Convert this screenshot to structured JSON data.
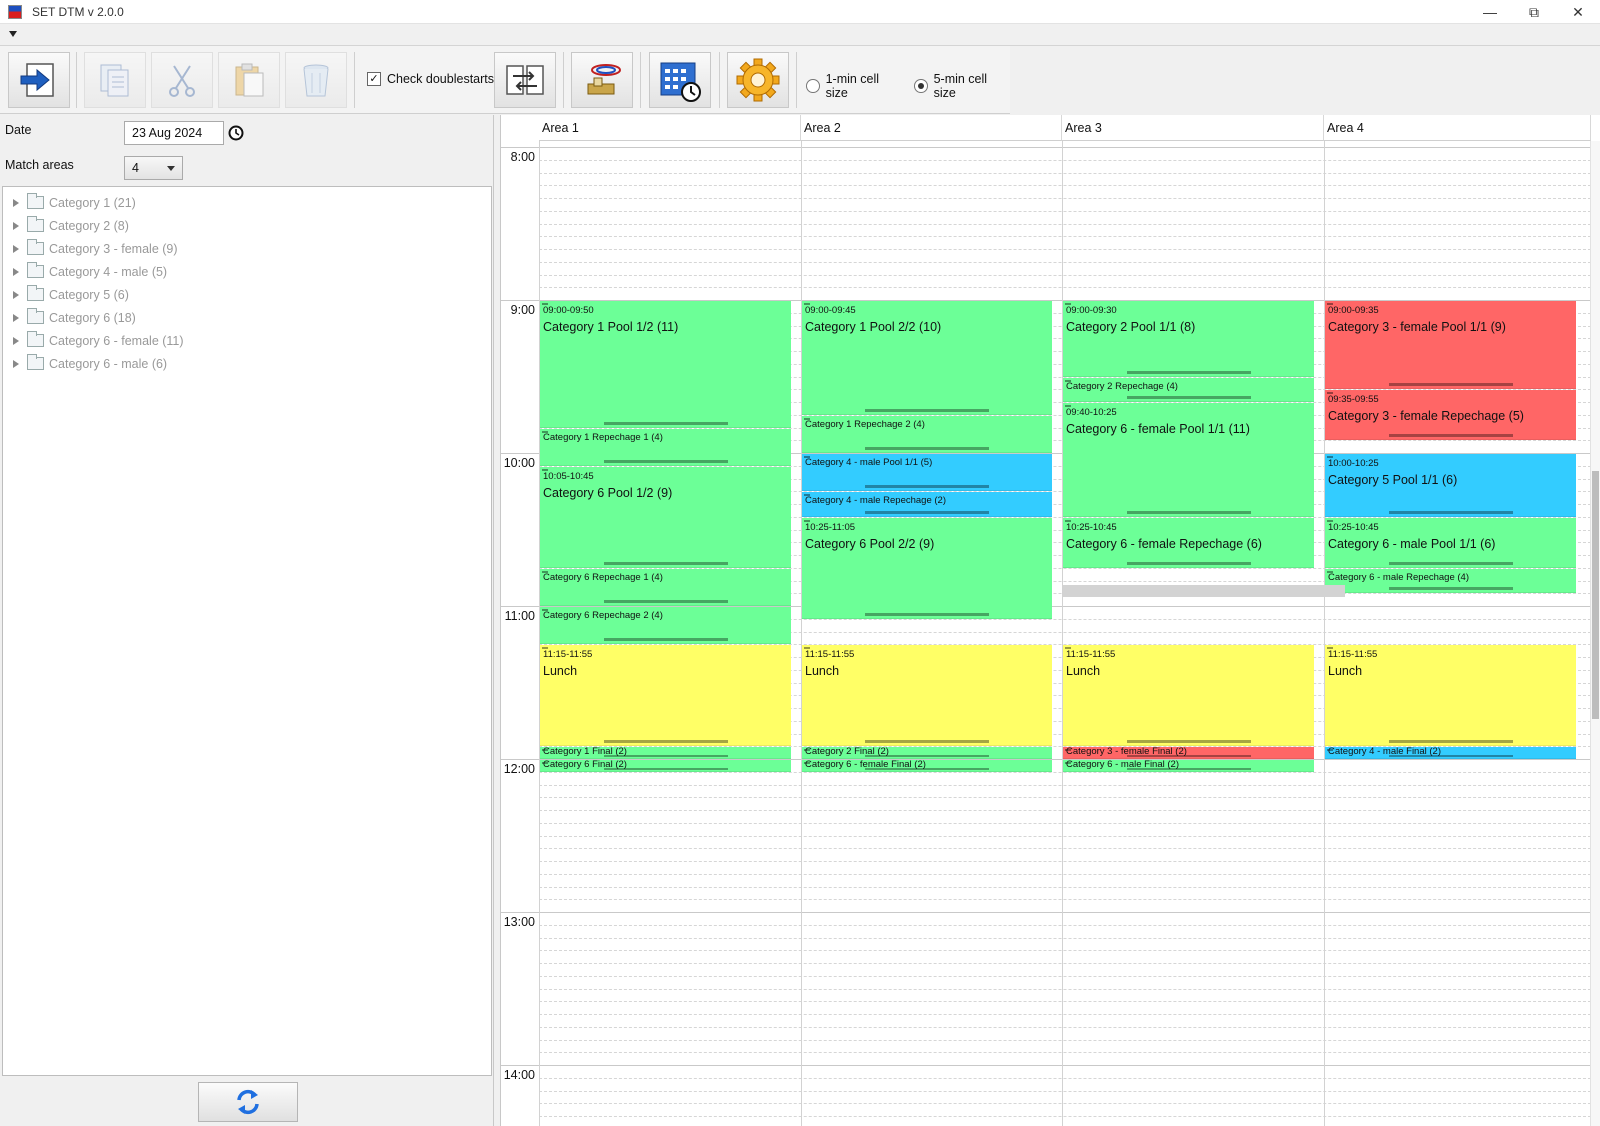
{
  "window": {
    "title": "SET DTM v 2.0.0"
  },
  "toolbar": {
    "check_doublestarts_label": "Check doublestarts",
    "check_doublestarts_checked": true,
    "cell_size_1_label": "1-min cell size",
    "cell_size_5_label": "5-min cell size",
    "selected_cell_size": "5-min cell size"
  },
  "sidebar": {
    "date_label": "Date",
    "date_value": "23 Aug 2024",
    "match_areas_label": "Match areas",
    "match_areas_value": "4",
    "categories": [
      "Category 1 (21)",
      "Category 2 (8)",
      "Category 3 - female (9)",
      "Category 4 - male (5)",
      "Category 5 (6)",
      "Category 6 (18)",
      "Category 6 - female (11)",
      "Category 6 - male (6)"
    ]
  },
  "schedule": {
    "areas": [
      "Area 1",
      "Area 2",
      "Area 3",
      "Area 4"
    ],
    "time_labels": [
      "8:00",
      "9:00",
      "10:00",
      "11:00",
      "12:00",
      "13:00",
      "14:00"
    ],
    "events": [
      {
        "area": 0,
        "start": "09:00",
        "end": "09:50",
        "range": "09:00-09:50",
        "name": "Category 1 Pool 1/2 (11)",
        "color": "green"
      },
      {
        "area": 0,
        "start": "09:50",
        "end": "10:05",
        "range": "",
        "name": "Category 1 Repechage 1 (4)",
        "color": "green"
      },
      {
        "area": 0,
        "start": "10:05",
        "end": "10:45",
        "range": "10:05-10:45",
        "name": "Category 6 Pool 1/2 (9)",
        "color": "green"
      },
      {
        "area": 0,
        "start": "10:45",
        "end": "11:00",
        "range": "",
        "name": "Category 6 Repechage 1 (4)",
        "color": "green"
      },
      {
        "area": 0,
        "start": "11:00",
        "end": "11:15",
        "range": "",
        "name": "Category 6 Repechage 2 (4)",
        "color": "green"
      },
      {
        "area": 0,
        "start": "11:15",
        "end": "11:55",
        "range": "11:15-11:55",
        "name": "Lunch",
        "color": "yellow"
      },
      {
        "area": 0,
        "start": "11:55",
        "end": "12:00",
        "range": "",
        "name": "Category 1 Final (2)",
        "color": "green"
      },
      {
        "area": 0,
        "start": "12:00",
        "end": "12:05",
        "range": "",
        "name": "Category 6 Final (2)",
        "color": "green"
      },
      {
        "area": 1,
        "start": "09:00",
        "end": "09:45",
        "range": "09:00-09:45",
        "name": "Category 1 Pool 2/2 (10)",
        "color": "green"
      },
      {
        "area": 1,
        "start": "09:45",
        "end": "10:00",
        "range": "",
        "name": "Category 1 Repechage 2 (4)",
        "color": "green"
      },
      {
        "area": 1,
        "start": "10:00",
        "end": "10:15",
        "range": "",
        "name": "Category 4 - male Pool 1/1 (5)",
        "color": "blue"
      },
      {
        "area": 1,
        "start": "10:15",
        "end": "10:25",
        "range": "",
        "name": "Category 4 - male Repechage (2)",
        "color": "blue"
      },
      {
        "area": 1,
        "start": "10:25",
        "end": "11:05",
        "range": "10:25-11:05",
        "name": "Category 6 Pool 2/2 (9)",
        "color": "green"
      },
      {
        "area": 1,
        "start": "11:15",
        "end": "11:55",
        "range": "11:15-11:55",
        "name": "Lunch",
        "color": "yellow"
      },
      {
        "area": 1,
        "start": "11:55",
        "end": "12:00",
        "range": "",
        "name": "Category 2 Final (2)",
        "color": "green"
      },
      {
        "area": 1,
        "start": "12:00",
        "end": "12:05",
        "range": "",
        "name": "Category 6 - female Final (2)",
        "color": "green"
      },
      {
        "area": 2,
        "start": "09:00",
        "end": "09:30",
        "range": "09:00-09:30",
        "name": "Category 2 Pool 1/1 (8)",
        "color": "green"
      },
      {
        "area": 2,
        "start": "09:30",
        "end": "09:40",
        "range": "",
        "name": "Category 2 Repechage (4)",
        "color": "green"
      },
      {
        "area": 2,
        "start": "09:40",
        "end": "10:25",
        "range": "09:40-10:25",
        "name": "Category 6 - female Pool 1/1 (11)",
        "color": "green"
      },
      {
        "area": 2,
        "start": "10:25",
        "end": "10:45",
        "range": "10:25-10:45",
        "name": "Category 6 - female Repechage (6)",
        "color": "green"
      },
      {
        "area": 2,
        "start": "11:15",
        "end": "11:55",
        "range": "11:15-11:55",
        "name": "Lunch",
        "color": "yellow"
      },
      {
        "area": 2,
        "start": "11:55",
        "end": "12:00",
        "range": "",
        "name": "Category 3 - female Final (2)",
        "color": "red"
      },
      {
        "area": 2,
        "start": "12:00",
        "end": "12:05",
        "range": "",
        "name": "Category 6 - male Final (2)",
        "color": "green"
      },
      {
        "area": 3,
        "start": "09:00",
        "end": "09:35",
        "range": "09:00-09:35",
        "name": "Category 3 - female Pool 1/1 (9)",
        "color": "red"
      },
      {
        "area": 3,
        "start": "09:35",
        "end": "09:55",
        "range": "09:35-09:55",
        "name": "Category 3 - female Repechage (5)",
        "color": "red"
      },
      {
        "area": 3,
        "start": "10:00",
        "end": "10:25",
        "range": "10:00-10:25",
        "name": "Category 5 Pool 1/1 (6)",
        "color": "blue"
      },
      {
        "area": 3,
        "start": "10:25",
        "end": "10:45",
        "range": "10:25-10:45",
        "name": "Category 6 - male Pool 1/1 (6)",
        "color": "green"
      },
      {
        "area": 3,
        "start": "10:45",
        "end": "10:55",
        "range": "",
        "name": "Category 6 - male Repechage (4)",
        "color": "green"
      },
      {
        "area": 3,
        "start": "11:15",
        "end": "11:55",
        "range": "11:15-11:55",
        "name": "Lunch",
        "color": "yellow"
      },
      {
        "area": 3,
        "start": "11:55",
        "end": "12:00",
        "range": "",
        "name": "Category 4 - male Final (2)",
        "color": "blue"
      }
    ]
  },
  "colors": {
    "green": "#6cff97",
    "blue": "#33ccff",
    "red": "#ff6666",
    "yellow": "#ffff66"
  }
}
